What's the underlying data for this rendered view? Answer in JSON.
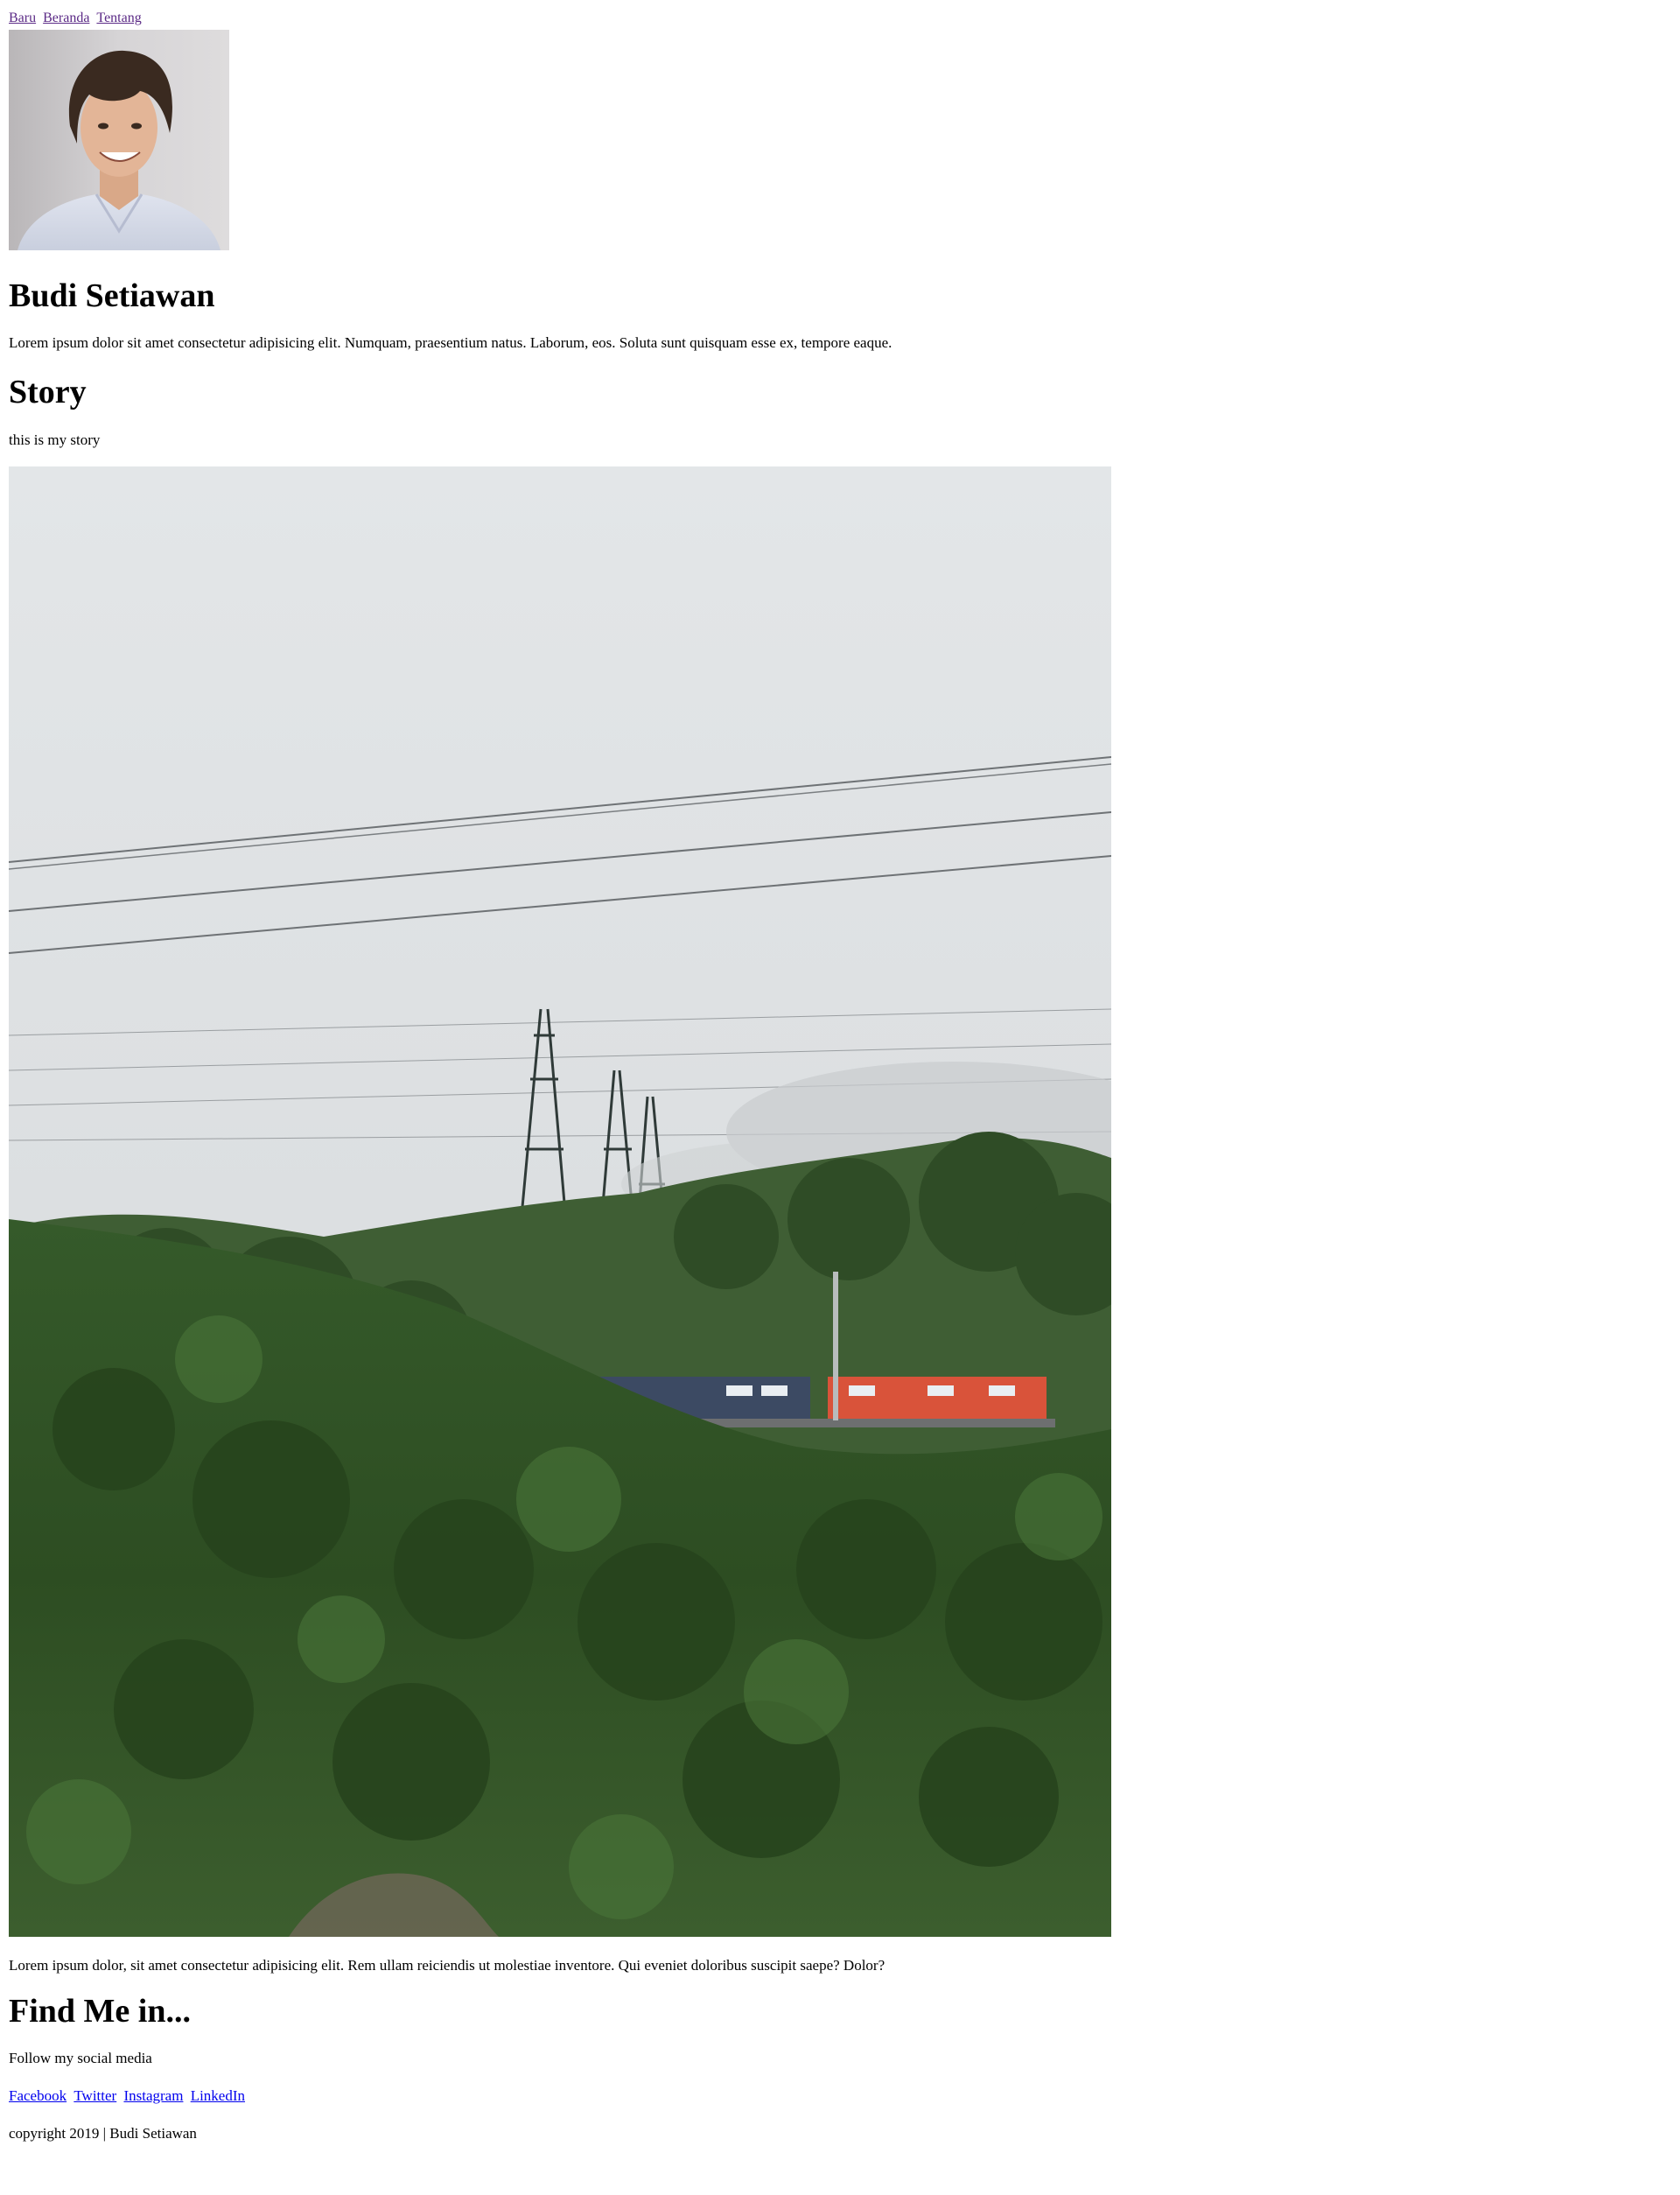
{
  "nav": {
    "items": [
      {
        "label": "Baru"
      },
      {
        "label": "Beranda"
      },
      {
        "label": "Tentang"
      }
    ]
  },
  "profile": {
    "name": "Budi Setiawan",
    "bio": "Lorem ipsum dolor sit amet consectetur adipisicing elit. Numquam, praesentium natus. Laborum, eos. Soluta sunt quisquam esse ex, tempore eaque."
  },
  "story": {
    "title": "Story",
    "text": "this is my story",
    "caption": "Lorem ipsum dolor, sit amet consectetur adipisicing elit. Rem ullam reiciendis ut molestiae inventore. Qui eveniet doloribus suscipit saepe? Dolor?"
  },
  "find": {
    "title": "Find Me in...",
    "text": "Follow my social media",
    "links": [
      {
        "label": "Facebook"
      },
      {
        "label": "Twitter"
      },
      {
        "label": "Instagram"
      },
      {
        "label": "LinkedIn"
      }
    ]
  },
  "footer": {
    "text": "copyright 2019 | Budi Setiawan"
  },
  "colors": {
    "visited_link": "#5b2a86",
    "link": "#0000ee",
    "text": "#000000",
    "background": "#ffffff"
  }
}
